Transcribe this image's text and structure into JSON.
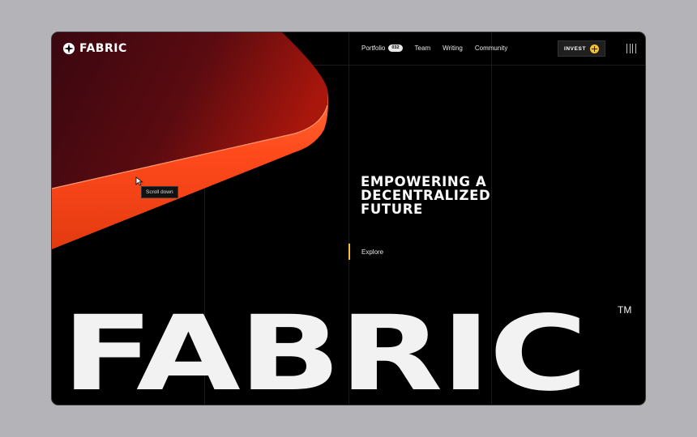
{
  "brand": {
    "name": "FABRIC",
    "icon": "star-cross-icon"
  },
  "nav": {
    "items": [
      {
        "label": "Portfolio",
        "badge": "032"
      },
      {
        "label": "Team"
      },
      {
        "label": "Writing"
      },
      {
        "label": "Community"
      }
    ],
    "invest_label": "INVEST",
    "invest_icon": "plus-circle-icon",
    "menu_icon": "hamburger-icon"
  },
  "hero": {
    "headline": [
      "EMPOWERING A",
      "DECENTRALIZED",
      "FUTURE"
    ],
    "cta": "Explore",
    "tooltip": "Scroll down",
    "big_word": "FABRIC",
    "trademark": "TM"
  },
  "colors": {
    "background": "#b4b4b8",
    "frame": "#000000",
    "accent_orange": "#ff4a1c",
    "accent_yellow": "#f2c230",
    "text": "#ffffff"
  }
}
